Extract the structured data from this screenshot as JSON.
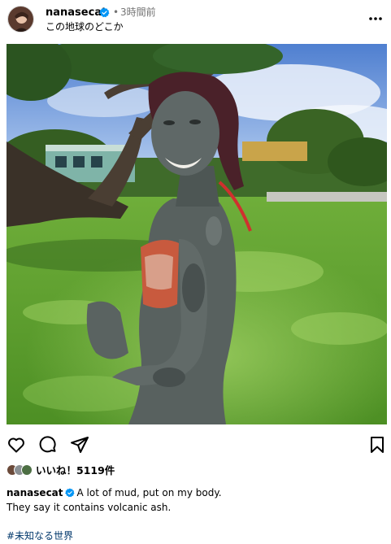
{
  "post": {
    "username": "nanasecat",
    "separator": "•",
    "time_ago": "3時間前",
    "location": "この地球のどこか"
  },
  "likes": {
    "label": "いいね！5119件"
  },
  "caption": {
    "username": "nanasecat",
    "line1": "A lot of mud, put on my body.",
    "line2": "They say it contains volcanic ash.",
    "hashtag": "#未知なる世界"
  },
  "icons": {
    "verified": "verified-badge-icon",
    "more": "more-options-icon",
    "like": "heart-icon",
    "comment": "comment-icon",
    "share": "share-icon",
    "save": "bookmark-icon"
  },
  "colors": {
    "verified_blue": "#0095f6",
    "hashtag_link": "#00376b",
    "muted_text": "#737373"
  }
}
